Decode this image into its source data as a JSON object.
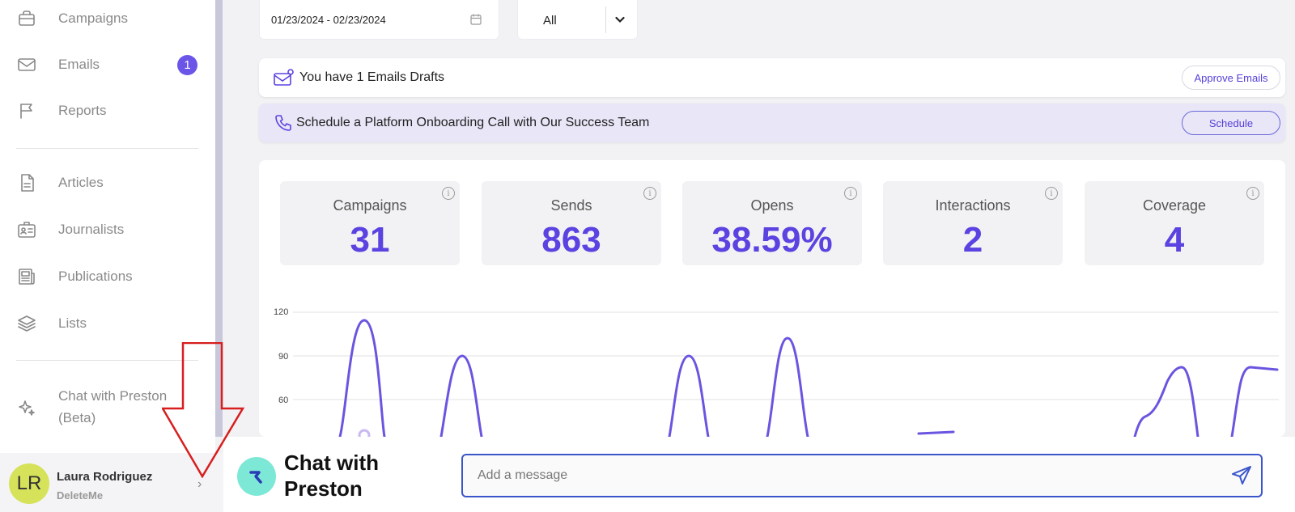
{
  "sidebar": {
    "items": [
      {
        "label": "Campaigns",
        "icon": "briefcase-icon"
      },
      {
        "label": "Emails",
        "icon": "mail-icon",
        "badge": "1"
      },
      {
        "label": "Reports",
        "icon": "flag-icon"
      },
      {
        "label": "Articles",
        "icon": "document-icon"
      },
      {
        "label": "Journalists",
        "icon": "id-card-icon"
      },
      {
        "label": "Publications",
        "icon": "newspaper-icon"
      },
      {
        "label": "Lists",
        "icon": "layers-icon"
      }
    ],
    "chat_item": {
      "label": "Chat with Preston (Beta)",
      "icon": "sparkle-icon"
    },
    "user": {
      "initials": "LR",
      "name": "Laura Rodriguez",
      "org": "DeleteMe"
    }
  },
  "filters": {
    "date_range": "01/23/2024 - 02/23/2024",
    "select_value": "All"
  },
  "banners": {
    "drafts": {
      "text": "You have 1 Emails Drafts",
      "button": "Approve Emails"
    },
    "schedule": {
      "text": "Schedule a Platform Onboarding Call with Our Success Team",
      "button": "Schedule"
    }
  },
  "stats": [
    {
      "label": "Campaigns",
      "value": "31"
    },
    {
      "label": "Sends",
      "value": "863"
    },
    {
      "label": "Opens",
      "value": "38.59%"
    },
    {
      "label": "Interactions",
      "value": "2"
    },
    {
      "label": "Coverage",
      "value": "4"
    }
  ],
  "chart_data": {
    "type": "line",
    "y_ticks": [
      "120",
      "90",
      "60"
    ],
    "series_color": "#6a55e0"
  },
  "chat": {
    "title": "Chat with Preston",
    "placeholder": "Add a message"
  },
  "colors": {
    "accent": "#5a43e0",
    "badge": "#6a55e8",
    "chat_logo": "#7de8d6",
    "avatar": "#d6e25a",
    "annotation_arrow": "#d81e1e"
  }
}
